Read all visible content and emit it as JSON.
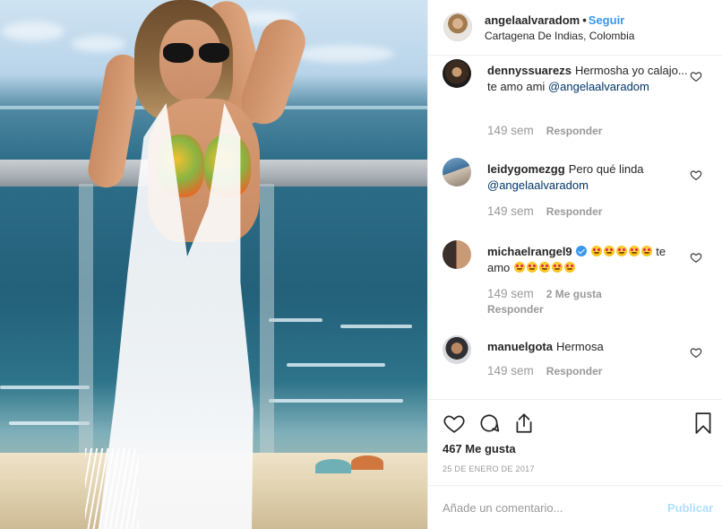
{
  "post": {
    "image_alt": "",
    "header": {
      "username": "angelaalvaradom",
      "separator": "•",
      "follow_label": "Seguir",
      "location": "Cartagena De Indias, Colombia",
      "avatar_icon": "user-avatar-icon"
    },
    "comments": [
      {
        "username": "dennyssuarezs",
        "text": "Hermosha yo calajo... te amo ami",
        "mention": "@angelaalvaradom",
        "time": "149 sem",
        "likes": "",
        "reply_label": "Responder",
        "verified": false
      },
      {
        "username": "leidygomezgg",
        "text": "Pero qué linda",
        "mention": "@angelaalvaradom",
        "time": "149 sem",
        "likes": "",
        "reply_label": "Responder",
        "verified": false
      },
      {
        "username": "michaelrangel9",
        "text_after_emoji": "te amo",
        "emoji_count_first": 5,
        "emoji_count_second": 5,
        "time": "149 sem",
        "likes": "2 Me gusta",
        "reply_label": "Responder",
        "verified": true
      },
      {
        "username": "manuelgota",
        "text": "Hermosa",
        "mention": "",
        "time": "149 sem",
        "likes": "",
        "reply_label": "Responder",
        "verified": false
      }
    ],
    "actions": {
      "like_icon": "heart-outline-icon",
      "comment_icon": "comment-bubble-icon",
      "share_icon": "share-upload-icon",
      "save_icon": "bookmark-icon"
    },
    "likes_count": "467 Me gusta",
    "date": "25 DE ENERO DE 2017",
    "add_comment": {
      "placeholder": "Añade un comentario...",
      "publish_label": "Publicar"
    }
  },
  "colors": {
    "accent": "#3897f0",
    "publish_disabled": "#b2dffc",
    "muted": "#999999",
    "text": "#262626",
    "mention": "#003569",
    "border": "#efefef"
  }
}
